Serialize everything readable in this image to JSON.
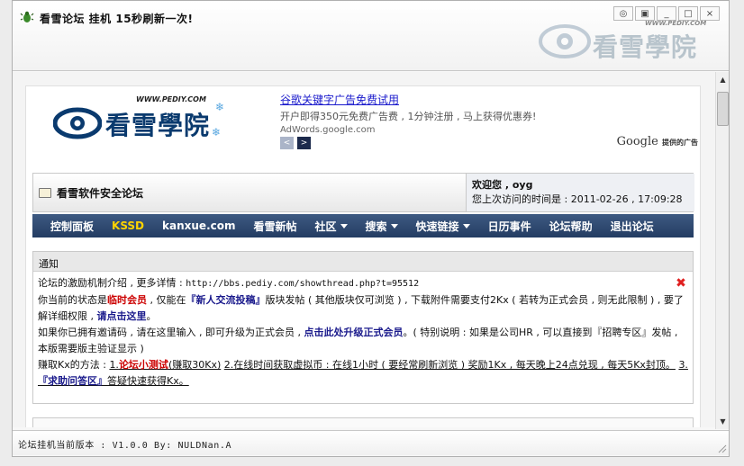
{
  "window": {
    "title": "看雪论坛 挂机 15秒刷新一次!",
    "title_logo_text": "看雪學院",
    "title_logo_url": "WWW.PEDIY.COM",
    "buttons": [
      "◎",
      "▣",
      "_",
      "□",
      "×"
    ]
  },
  "header": {
    "logo_text": "看雪學院",
    "logo_url": "WWW.PEDIY.COM",
    "ad": {
      "title": "谷歌关键字广告免费试用",
      "desc": "开户即得350元免费广告费 , 1分钟注册 , 马上获得优惠券!",
      "url": "AdWords.google.com",
      "prev": "<",
      "next": ">",
      "google": "Google",
      "provided": "提供的广告"
    }
  },
  "forum": {
    "name": "看雪软件安全论坛",
    "welcome": "欢迎您 , oyg",
    "last_visit": "您上次访问的时间是 : 2011-02-26 , 17:09:28"
  },
  "nav": {
    "items": [
      {
        "label": "控制面板",
        "hi": false,
        "caret": false
      },
      {
        "label": "KSSD",
        "hi": true,
        "caret": false
      },
      {
        "label": "kanxue.com",
        "hi": false,
        "caret": false
      },
      {
        "label": "看雪新帖",
        "hi": false,
        "caret": false
      },
      {
        "label": "社区",
        "hi": false,
        "caret": true
      },
      {
        "label": "搜索",
        "hi": false,
        "caret": true
      },
      {
        "label": "快速链接",
        "hi": false,
        "caret": true
      },
      {
        "label": "日历事件",
        "hi": false,
        "caret": false
      },
      {
        "label": "论坛帮助",
        "hi": false,
        "caret": false
      },
      {
        "label": "退出论坛",
        "hi": false,
        "caret": false
      }
    ]
  },
  "notice": {
    "title": "通知",
    "line1_prefix": "论坛的激励机制介绍 , 更多详情 : ",
    "line1_url": "http://bbs.pediy.com/showthread.php?t=95512",
    "p2_a": "你当前的状态是",
    "p2_status": "临时会员",
    "p2_b": " , 仅能在",
    "p2_board": "『新人交流投稿』",
    "p2_c": "版块发帖 ( 其他版块仅可浏览 ) , 下载附件需要支付2Kx ( 若转为正式会员 , 则无此限制 ) , 要了解详细权限 , ",
    "p2_link": "请点击这里",
    "p2_d": "。",
    "p3_a": "如果你已拥有邀请码 , 请在这里输入 , 即可升级为正式会员 , ",
    "p3_link": "点击此处升级正式会员",
    "p3_b": "。( 特别说明 : 如果是公司HR , 可以直接到『招聘专区』发帖 , 本版需要版主验证显示 )",
    "p4_a": "赚取Kx的方法 : ",
    "p4_1a": "1.",
    "p4_1b": "论坛小测试",
    "p4_1c": "(赚取30Kx)",
    "p4_2": "2.在线时间获取虚拟币 : 在线1小时 ( 要经常刷新浏览 ) 奖励1Kx , 每天晚上24点兑现 , 每天5Kx封顶。",
    "p4_3a": "3.",
    "p4_3b": "『求助问答区』",
    "p4_3c": "答疑快速获得Kx。"
  },
  "status": {
    "text": "论坛挂机当前版本 : V1.0.0    By: NULDNan.A"
  }
}
